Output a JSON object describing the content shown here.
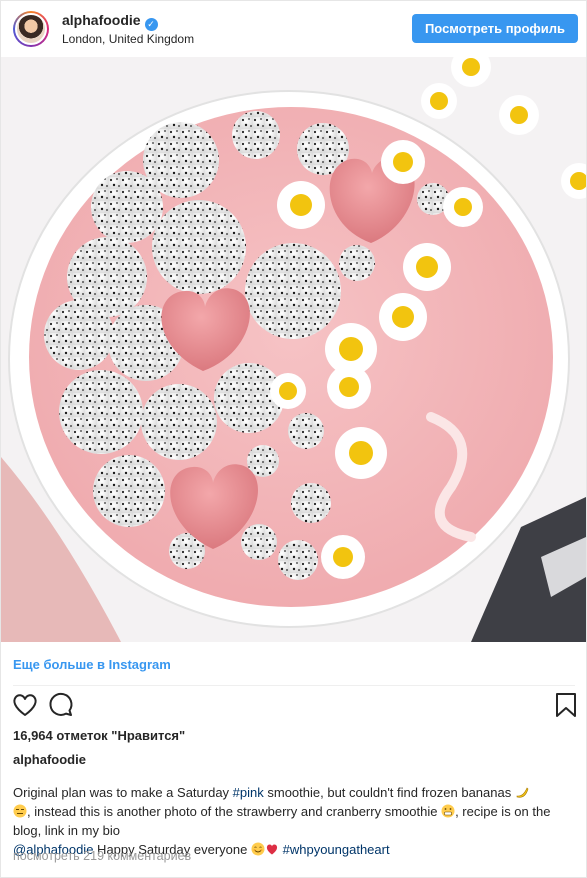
{
  "header": {
    "username": "alphafoodie",
    "location": "London, United Kingdom",
    "view_profile_label": "Посмотреть профиль",
    "verified_icon": "verified-badge-icon"
  },
  "photo": {
    "icon": "smoothie-bowl-photo"
  },
  "more_link": "Еще больше в Instagram",
  "actions": {
    "like_icon": "heart-outline-icon",
    "comment_icon": "comment-bubble-icon",
    "save_icon": "bookmark-icon"
  },
  "likes": "16,964 отметок \"Нравится\"",
  "post_username": "alphafoodie",
  "caption": {
    "part1": "Original plan was to make a Saturday ",
    "hashtag_pink": "#pink",
    "part2": " smoothie, but couldn't find frozen bananas ",
    "part3": ", instead this is another photo of the strawberry and cranberry smoothie ",
    "part4": ", recipe is on the blog, link in my bio ",
    "mention": "@alphafoodie",
    "part5": " Happy Saturday everyone ",
    "hashtag_young": "#whpyoungatheart",
    "emojis": [
      "banana-emoji",
      "expressionless-emoji",
      "grinning-emoji",
      "smiling-emoji",
      "heart-emoji"
    ]
  },
  "view_comments": "посмотреть 219 комментариев",
  "colors": {
    "accent": "#3897f0",
    "hashtag": "#003569",
    "smoothie_pink": "#f3b3b6",
    "heart_pink": "#e98a8e"
  }
}
